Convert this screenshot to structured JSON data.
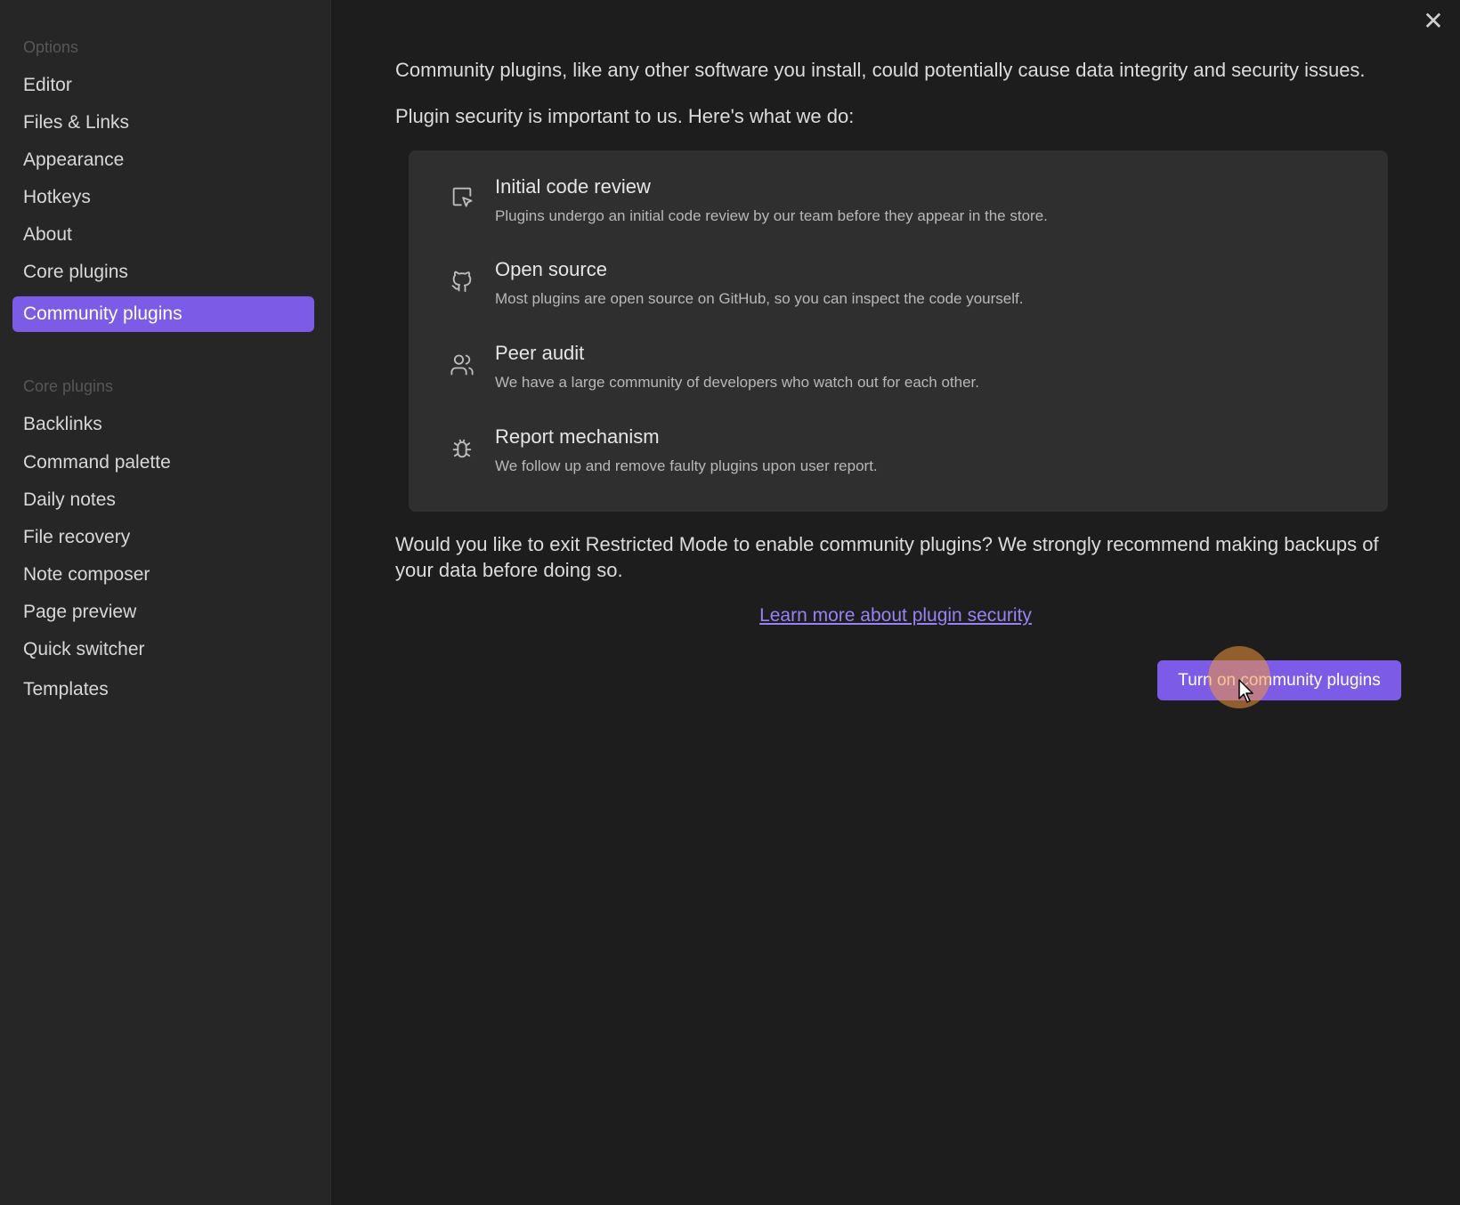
{
  "window": {
    "close_symbol": "✕"
  },
  "sidebar": {
    "options_heading": "Options",
    "options_items": [
      {
        "label": "Editor"
      },
      {
        "label": "Files & Links"
      },
      {
        "label": "Appearance"
      },
      {
        "label": "Hotkeys"
      },
      {
        "label": "About"
      },
      {
        "label": "Core plugins"
      },
      {
        "label": "Community plugins",
        "active": true
      }
    ],
    "core_plugins_heading": "Core plugins",
    "core_plugin_items": [
      {
        "label": "Backlinks"
      },
      {
        "label": "Command palette"
      },
      {
        "label": "Daily notes"
      },
      {
        "label": "File recovery"
      },
      {
        "label": "Note composer"
      },
      {
        "label": "Page preview"
      },
      {
        "label": "Quick switcher"
      },
      {
        "label": "Templates"
      }
    ]
  },
  "main": {
    "intro_warning": "Community plugins, like any other software you install, could potentially cause data integrity and security issues.",
    "intro_security": "Plugin security is important to us. Here's what we do:",
    "features": [
      {
        "icon": "code-review-icon",
        "title": "Initial code review",
        "description": "Plugins undergo an initial code review by our team before they appear in the store."
      },
      {
        "icon": "github-icon",
        "title": "Open source",
        "description": "Most plugins are open source on GitHub, so you can inspect the code yourself."
      },
      {
        "icon": "users-icon",
        "title": "Peer audit",
        "description": "We have a large community of developers who watch out for each other."
      },
      {
        "icon": "bug-icon",
        "title": "Report mechanism",
        "description": "We follow up and remove faulty plugins upon user report."
      }
    ],
    "question": "Would you like to exit Restricted Mode to enable community plugins? We strongly recommend making backups of your data before doing so.",
    "learn_more_link": "Learn more about plugin security",
    "turn_on_button": "Turn on community plugins"
  },
  "colors": {
    "accent": "#7c5ce6",
    "link": "#9a82f2",
    "sidebar_bg": "#262626",
    "main_bg": "#1d1d1d",
    "card_bg": "#2f2f2f"
  }
}
